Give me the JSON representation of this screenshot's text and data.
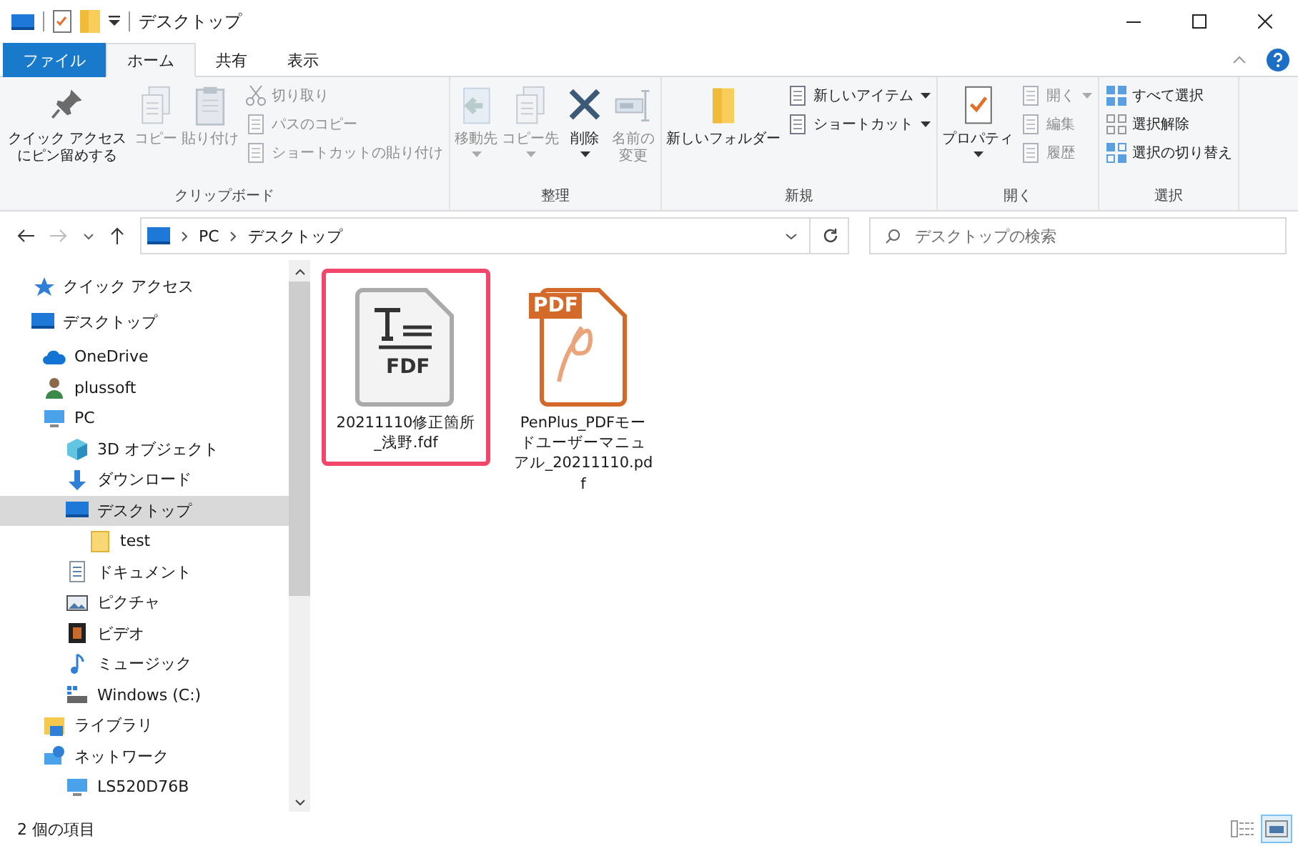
{
  "window": {
    "title": "デスクトップ"
  },
  "tabs": [
    {
      "label": "ファイル",
      "kind": "file",
      "selected": false
    },
    {
      "label": "ホーム",
      "kind": "tab",
      "selected": true
    },
    {
      "label": "共有",
      "kind": "tab",
      "selected": false
    },
    {
      "label": "表示",
      "kind": "tab",
      "selected": false
    }
  ],
  "ribbon": {
    "groups": [
      {
        "label": "クリップボード",
        "large": [
          {
            "label": "クイック アクセスにピン留めする",
            "kind": "pin",
            "disabled": false,
            "dropdown": false
          },
          {
            "label": "コピー",
            "kind": "copy",
            "disabled": true,
            "dropdown": false
          },
          {
            "label": "貼り付け",
            "kind": "paste",
            "disabled": true,
            "dropdown": false
          }
        ],
        "small": [
          {
            "label": "切り取り",
            "kind": "cut",
            "disabled": true,
            "dropdown": false
          },
          {
            "label": "パスのコピー",
            "kind": "path",
            "disabled": true,
            "dropdown": false
          },
          {
            "label": "ショートカットの貼り付け",
            "kind": "shortcut",
            "disabled": true,
            "dropdown": false
          }
        ]
      },
      {
        "label": "整理",
        "large": [
          {
            "label": "移動先",
            "kind": "move",
            "disabled": true,
            "dropdown": true
          },
          {
            "label": "コピー先",
            "kind": "copy",
            "disabled": true,
            "dropdown": true
          },
          {
            "label": "削除",
            "kind": "delete",
            "disabled": false,
            "dropdown": true
          },
          {
            "label": "名前の変更",
            "kind": "rename",
            "disabled": true,
            "dropdown": false
          }
        ]
      },
      {
        "label": "新規",
        "large": [
          {
            "label": "新しいフォルダー",
            "kind": "folder",
            "disabled": false,
            "dropdown": false
          }
        ],
        "small": [
          {
            "label": "新しいアイテム",
            "kind": "newitem",
            "disabled": false,
            "dropdown": true
          },
          {
            "label": "ショートカット",
            "kind": "shortcut",
            "disabled": false,
            "dropdown": true
          }
        ]
      },
      {
        "label": "開く",
        "large": [
          {
            "label": "プロパティ",
            "kind": "properties",
            "disabled": false,
            "dropdown": true
          }
        ],
        "small": [
          {
            "label": "開く",
            "kind": "open",
            "disabled": true,
            "dropdown": true
          },
          {
            "label": "編集",
            "kind": "edit",
            "disabled": true,
            "dropdown": false
          },
          {
            "label": "履歴",
            "kind": "history",
            "disabled": true,
            "dropdown": false
          }
        ]
      },
      {
        "label": "選択",
        "small": [
          {
            "label": "すべて選択",
            "kind": "selectall",
            "disabled": false,
            "dropdown": false
          },
          {
            "label": "選択解除",
            "kind": "selectnone",
            "disabled": false,
            "dropdown": false
          },
          {
            "label": "選択の切り替え",
            "kind": "invert",
            "disabled": false,
            "dropdown": false
          }
        ]
      }
    ]
  },
  "address": {
    "path": [
      "PC",
      "デスクトップ"
    ]
  },
  "search": {
    "placeholder": "デスクトップの検索"
  },
  "sidebar": {
    "items": [
      {
        "label": "クイック アクセス",
        "kind": "star",
        "selected": false
      },
      {
        "label": "デスクトップ",
        "kind": "desktop",
        "selected": false,
        "children": [
          {
            "label": "OneDrive",
            "kind": "cloud",
            "selected": false
          },
          {
            "label": "plussoft",
            "kind": "user",
            "selected": false
          },
          {
            "label": "PC",
            "kind": "pc",
            "selected": false,
            "children": [
              {
                "label": "3D オブジェクト",
                "kind": "cube",
                "selected": false
              },
              {
                "label": "ダウンロード",
                "kind": "download",
                "selected": false
              },
              {
                "label": "デスクトップ",
                "kind": "desktop",
                "selected": true,
                "children": [
                  {
                    "label": "test",
                    "kind": "folder",
                    "selected": false
                  }
                ]
              },
              {
                "label": "ドキュメント",
                "kind": "document",
                "selected": false
              },
              {
                "label": "ピクチャ",
                "kind": "picture",
                "selected": false
              },
              {
                "label": "ビデオ",
                "kind": "video",
                "selected": false
              },
              {
                "label": "ミュージック",
                "kind": "music",
                "selected": false
              },
              {
                "label": "Windows (C:)",
                "kind": "drive",
                "selected": false
              }
            ]
          },
          {
            "label": "ライブラリ",
            "kind": "library",
            "selected": false
          },
          {
            "label": "ネットワーク",
            "kind": "network",
            "selected": false,
            "children": [
              {
                "label": "LS520D76B",
                "kind": "pc",
                "selected": false
              }
            ]
          }
        ]
      }
    ]
  },
  "files": [
    {
      "name": "20211110修正箇所_浅野.fdf",
      "kind": "fdf",
      "icon_label": "FDF",
      "highlighted": true
    },
    {
      "name": "PenPlus_PDFモードユーザーマニュアル_20211110.pdf",
      "kind": "pdf",
      "icon_label": "PDF",
      "highlighted": false
    }
  ],
  "status_bar": {
    "text": "2 個の項目",
    "views": [
      {
        "kind": "details",
        "selected": false
      },
      {
        "kind": "large-icons",
        "selected": true
      }
    ]
  }
}
